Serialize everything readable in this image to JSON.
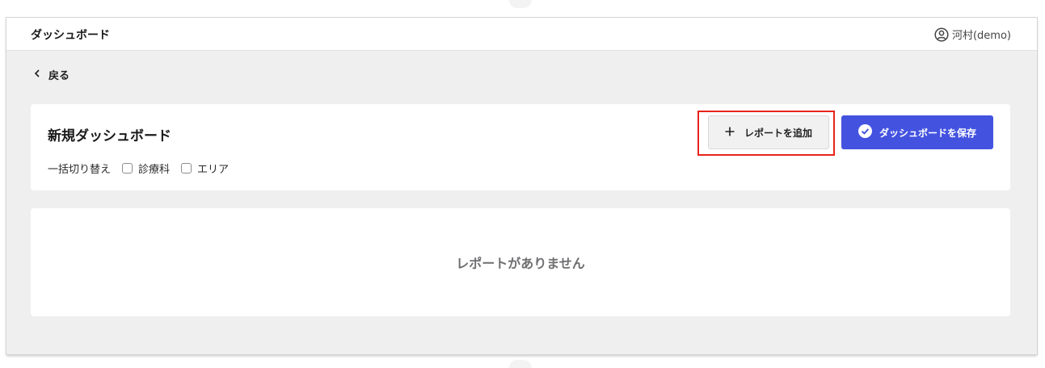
{
  "header": {
    "app_title": "ダッシュボード",
    "user_icon": "user-circle-icon",
    "user_name": "河村(demo)"
  },
  "nav": {
    "back_icon": "chevron-left-icon",
    "back_label": "戻る"
  },
  "dashboard": {
    "title": "新規ダッシュボード",
    "bulk_toggle_label": "一括切り替え",
    "filters": [
      {
        "label": "診療科",
        "checked": false
      },
      {
        "label": "エリア",
        "checked": false
      }
    ]
  },
  "actions": {
    "add_report_icon": "plus-icon",
    "add_report_label": "レポートを追加",
    "save_icon": "check-circle-icon",
    "save_label": "ダッシュボードを保存",
    "save_color": "#4353e0",
    "highlight_color": "#e8231b"
  },
  "reports": {
    "empty_message": "レポートがありません"
  }
}
